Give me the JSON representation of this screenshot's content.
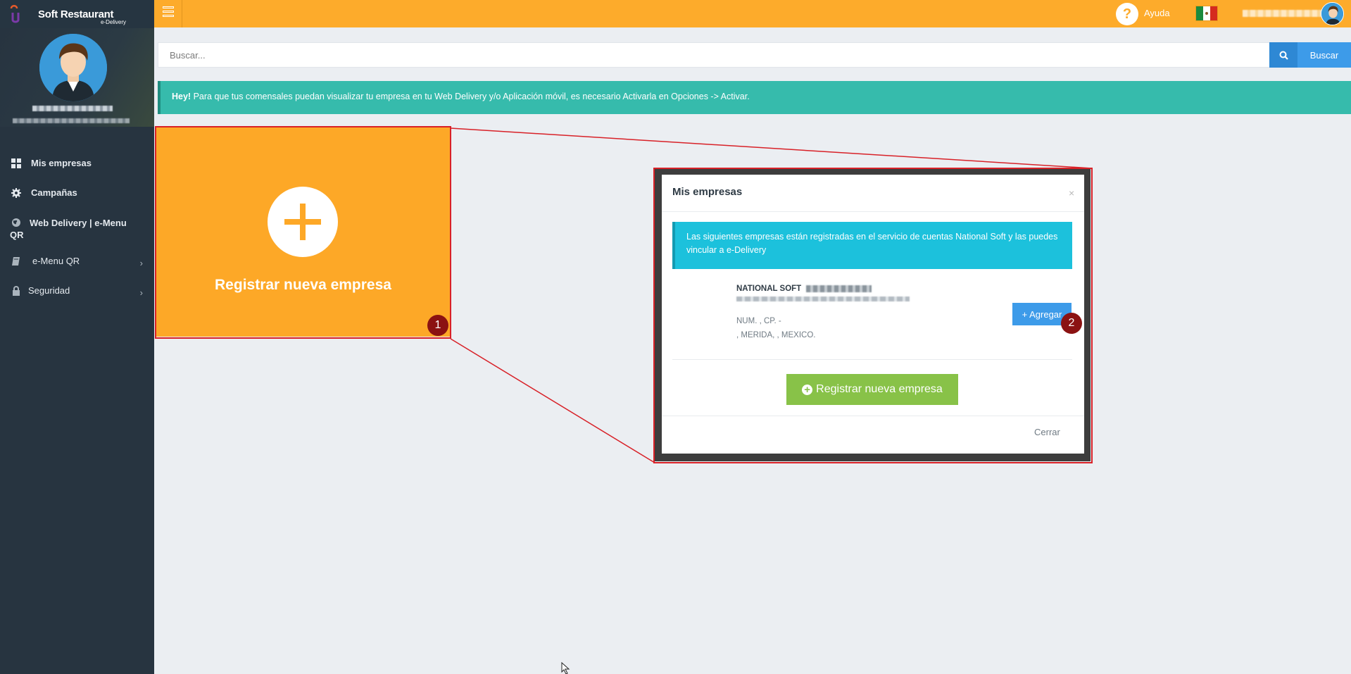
{
  "sidebar": {
    "brand_title": "Soft Restaurant",
    "brand_sub": "e-Delivery",
    "items": [
      {
        "label": "Mis empresas",
        "icon": "grid-icon"
      },
      {
        "label": "Campañas",
        "icon": "gear-icon"
      },
      {
        "label": "Web Delivery | e-Menu QR",
        "icon": "globe-icon"
      },
      {
        "label": "e-Menu QR",
        "icon": "book-icon"
      },
      {
        "label": "Seguridad",
        "icon": "lock-icon"
      }
    ]
  },
  "topbar": {
    "help_label": "Ayuda",
    "help_glyph": "?"
  },
  "search": {
    "placeholder": "Buscar...",
    "button_label": "Buscar"
  },
  "alert": {
    "strong": "Hey!",
    "text": " Para que tus comensales puedan visualizar tu empresa en tu Web Delivery y/o Aplicación móvil, es necesario Activarla en Opciones -> Activar."
  },
  "tile": {
    "label": "Registrar nueva empresa"
  },
  "annotations": [
    "1",
    "2"
  ],
  "modal": {
    "title": "Mis empresas",
    "close": "×",
    "info": "Las siguientes empresas están registradas en el servicio de cuentas National Soft y las puedes vincular a e-Delivery",
    "company_name": "NATIONAL SOFT",
    "address_line1": "NUM. , CP. -",
    "address_line2": ", MERIDA, , MEXICO.",
    "add_button": "+ Agregar",
    "register_button": "Registrar nueva empresa",
    "close_button": "Cerrar"
  },
  "colors": {
    "topbar": "#fdab2b",
    "sidebar": "#273440",
    "alert": "#36bbac",
    "info": "#1cc1dc",
    "primary": "#3d9be9",
    "success": "#88c248",
    "annotation": "#d82027"
  }
}
